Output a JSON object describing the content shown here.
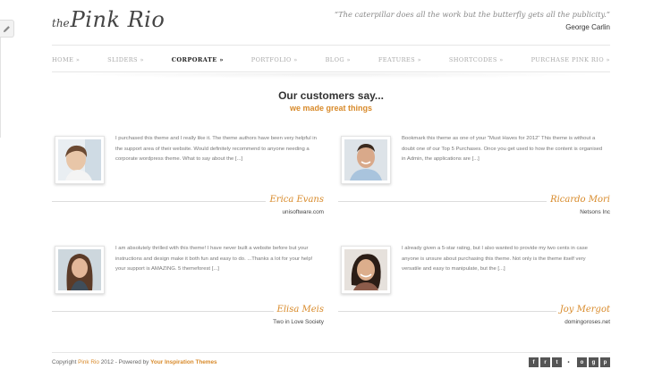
{
  "header": {
    "logo_small": "the",
    "logo_main": "Pink Rio",
    "quote": "“The caterpillar does all the work but the butterfly gets all the publicity.”",
    "quote_author": "George Carlin"
  },
  "nav": {
    "items": [
      {
        "label": "HOME »"
      },
      {
        "label": "SLIDERS »"
      },
      {
        "label": "CORPORATE »"
      },
      {
        "label": "PORTFOLIO »"
      },
      {
        "label": "BLOG »"
      },
      {
        "label": "FEATURES »"
      },
      {
        "label": "SHORTCODES »"
      },
      {
        "label": "PURCHASE PINK RIO »"
      }
    ]
  },
  "section": {
    "title": "Our customers say...",
    "subtitle": "we made great things"
  },
  "testimonials": [
    {
      "text": "I purchased this theme and I really like it. The theme authors have been very helpful in the support area of their website. Would definitely recommend to anyone needing a corporate wordpress theme. What to say about the [...]",
      "name": "Erica Evans",
      "company": "unisoftware.com"
    },
    {
      "text": "Bookmark this theme as one of your \"Must Haves for 2012\" This theme is without a doubt one of our Top 5 Purchases. Once you get used to how the content is organised in Admin, the applications are [...]",
      "name": "Ricardo Mori",
      "company": "Netsons Inc"
    },
    {
      "text": "I am absolutely thrilled with this theme! I have never built a website before but your instructions and design make it both fun and easy to do. ...Thanks a lot for your help! your support is AMAZING. 5 themeforest [...]",
      "name": "Elisa Meis",
      "company": "Two in Love Society"
    },
    {
      "text": "I already given a 5-star rating, but I also wanted to provide my two cents in case anyone is unsure about purchasing this theme. Not only is the theme itself very versatile and easy to manipulate, but the [...]",
      "name": "Joy Mergot",
      "company": "domingoroses.net"
    }
  ],
  "footer": {
    "copyright_prefix": "Copyright ",
    "site_link": "Pink Rio",
    "copyright_mid": " 2012 - Powered by ",
    "powered_link": "Your Inspiration Themes",
    "socials": [
      "f",
      "r",
      "t",
      "•",
      "o",
      "g",
      "p"
    ]
  },
  "colors": {
    "accent": "#d88a2a",
    "text": "#555555",
    "social_bg": "#555555"
  }
}
